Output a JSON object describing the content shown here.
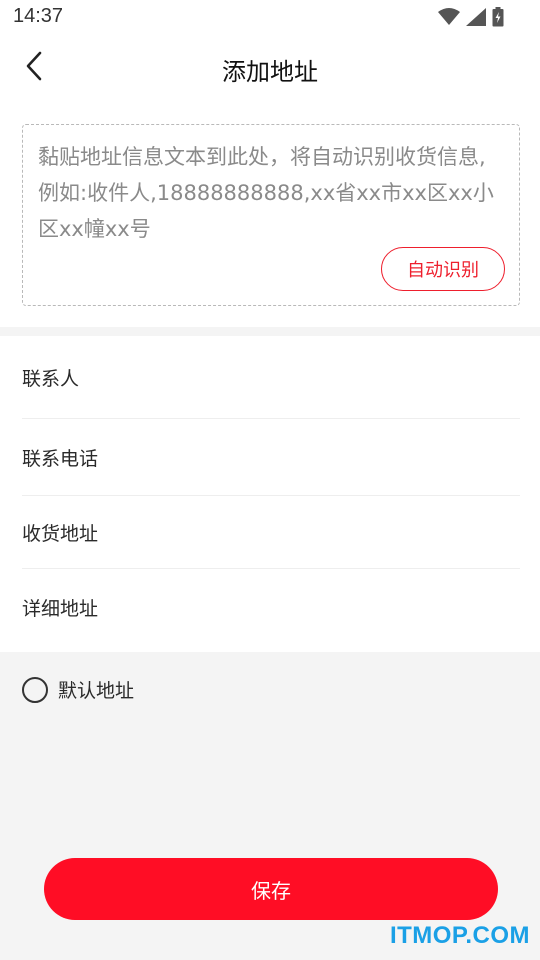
{
  "status_bar": {
    "time": "14:37"
  },
  "header": {
    "title": "添加地址"
  },
  "paste_box": {
    "placeholder": "黏贴地址信息文本到此处，将自动识别收货信息,例如:收件人,18888888888,xx省xx市xx区xx小区xx幢xx号",
    "auto_detect_label": "自动识别"
  },
  "form": {
    "fields": [
      {
        "label": "联系人"
      },
      {
        "label": "联系电话"
      },
      {
        "label": "收货地址"
      },
      {
        "label": "详细地址"
      }
    ]
  },
  "default_address": {
    "label": "默认地址",
    "checked": false
  },
  "save": {
    "label": "保存"
  },
  "watermark": {
    "text": "ITMOP.COM"
  },
  "colors": {
    "accent": "#ff0d25",
    "accent_border": "#ee1f2d",
    "watermark": "#1aa0e6"
  }
}
